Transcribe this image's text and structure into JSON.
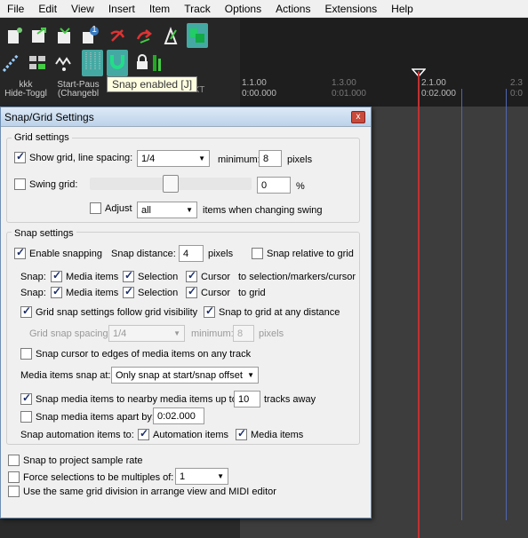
{
  "menu": [
    "File",
    "Edit",
    "View",
    "Insert",
    "Item",
    "Track",
    "Options",
    "Actions",
    "Extensions",
    "Help"
  ],
  "toolbar": {
    "label_a_line1": "kkk",
    "label_a_line2": "Hide-Toggl",
    "label_b_line1": "Start-Paus",
    "label_b_line2": "(Changebl",
    "label_c": "XT",
    "badge": "1",
    "tooltip": "Snap enabled [J]",
    "accent": "#44a9a3"
  },
  "ruler": {
    "ticks": [
      {
        "main": "1.1.00",
        "sub": "0:00.000",
        "dim": false
      },
      {
        "main": "1.3.00",
        "sub": "0:01.000",
        "dim": true
      },
      {
        "main": "2.1.00",
        "sub": "0:02.000",
        "dim": false
      },
      {
        "main": "2.3",
        "sub": "0:0",
        "dim": true
      }
    ]
  },
  "dialog": {
    "title": "Snap/Grid Settings",
    "close": "x",
    "grid": {
      "title": "Grid settings",
      "show_grid_label": "Show grid, line spacing:",
      "line_spacing": "1/4",
      "minimum_label": "minimum:",
      "minimum_value": "8",
      "pixels": "pixels",
      "swing_label": "Swing grid:",
      "swing_value": "0",
      "swing_unit": "%",
      "adjust_label": "Adjust",
      "adjust_value": "all",
      "adjust_suffix": "items when changing swing"
    },
    "snap": {
      "title": "Snap settings",
      "enable_label": "Enable snapping",
      "distance_label": "Snap distance:",
      "distance_value": "4",
      "distance_unit": "pixels",
      "relative_label": "Snap relative to grid",
      "snap_label": "Snap:",
      "media_items": "Media items",
      "selection": "Selection",
      "cursor": "Cursor",
      "row1_suffix": "to selection/markers/cursor",
      "row2_suffix": "to grid",
      "follow_visibility": "Grid snap settings follow grid visibility",
      "any_distance": "Snap to grid at any distance",
      "spacing_label": "Grid snap spacing:",
      "spacing_value": "1/4",
      "spacing_min_label": "minimum:",
      "spacing_min_value": "8",
      "spacing_pixels": "pixels",
      "cursor_edges": "Snap cursor to edges of media items on any track",
      "media_snap_at_label": "Media items snap at:",
      "media_snap_at_value": "Only snap at start/snap offset",
      "nearby_label": "Snap media items to nearby media items up to:",
      "nearby_value": "10",
      "nearby_suffix": "tracks away",
      "apart_label": "Snap media items apart by:",
      "apart_value": "0:02.000",
      "automation_label": "Snap automation items to:",
      "automation_items": "Automation items",
      "automation_media": "Media items"
    },
    "bottom": {
      "sample_rate": "Snap to project sample rate",
      "force_multiples": "Force selections to be multiples of:",
      "multiples_value": "1",
      "same_grid": "Use the same grid division in arrange view and MIDI editor"
    }
  }
}
